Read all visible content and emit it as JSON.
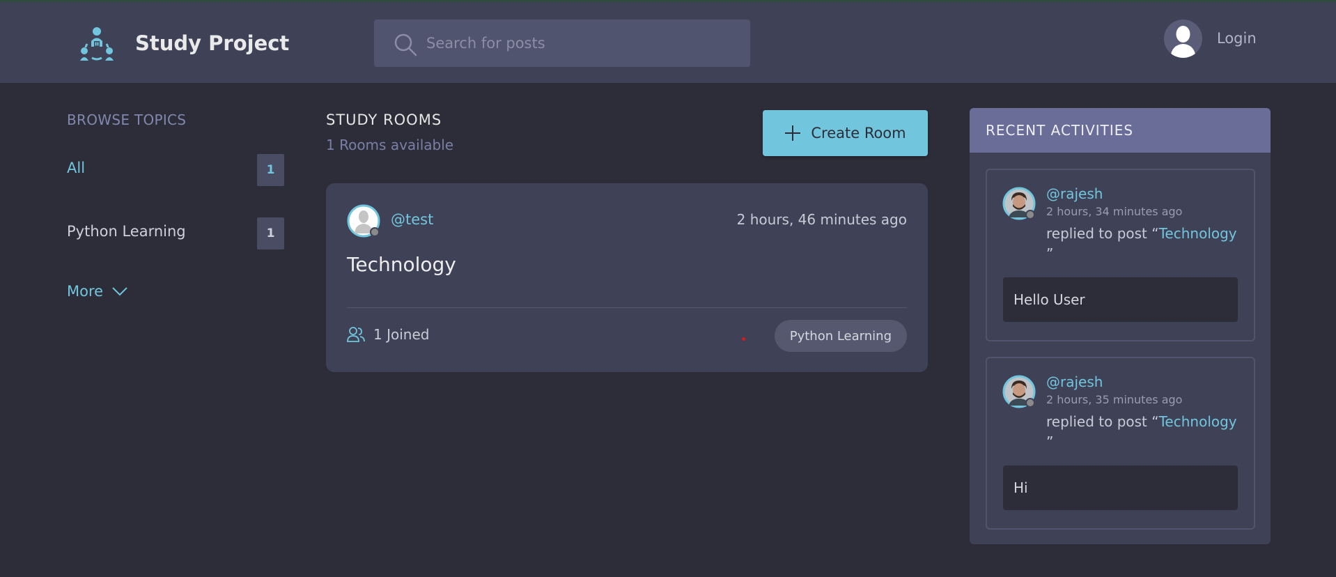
{
  "header": {
    "brand": "Study Project",
    "search_placeholder": "Search for posts",
    "login_label": "Login"
  },
  "topics": {
    "title": "BROWSE TOPICS",
    "items": [
      {
        "label": "All",
        "count": "1"
      },
      {
        "label": "Python Learning",
        "count": "1"
      }
    ],
    "more_label": "More"
  },
  "rooms": {
    "title": "STUDY ROOMS",
    "subtitle": "1 Rooms available",
    "create_label": "Create Room",
    "list": [
      {
        "host": "@test",
        "time": "2 hours, 46 minutes ago",
        "title": "Technology",
        "joined": "1 Joined",
        "topic": "Python Learning"
      }
    ]
  },
  "activities": {
    "title": "RECENT ACTIVITIES",
    "items": [
      {
        "user": "@rajesh",
        "time": "2 hours, 34 minutes ago",
        "action_prefix": "replied to post “",
        "post": "Technology",
        "action_suffix": "”",
        "message": "Hello User"
      },
      {
        "user": "@rajesh",
        "time": "2 hours, 35 minutes ago",
        "action_prefix": "replied to post “",
        "post": "Technology",
        "action_suffix": "”",
        "message": "Hi"
      }
    ]
  },
  "colors": {
    "accent": "#71c6dd",
    "background": "#2d2d39",
    "surface": "#3f4156",
    "panel_header": "#696d97"
  },
  "icons": [
    "app-logo-icon",
    "search-icon",
    "user-avatar-icon",
    "chevron-down-icon",
    "plus-icon",
    "users-icon"
  ]
}
